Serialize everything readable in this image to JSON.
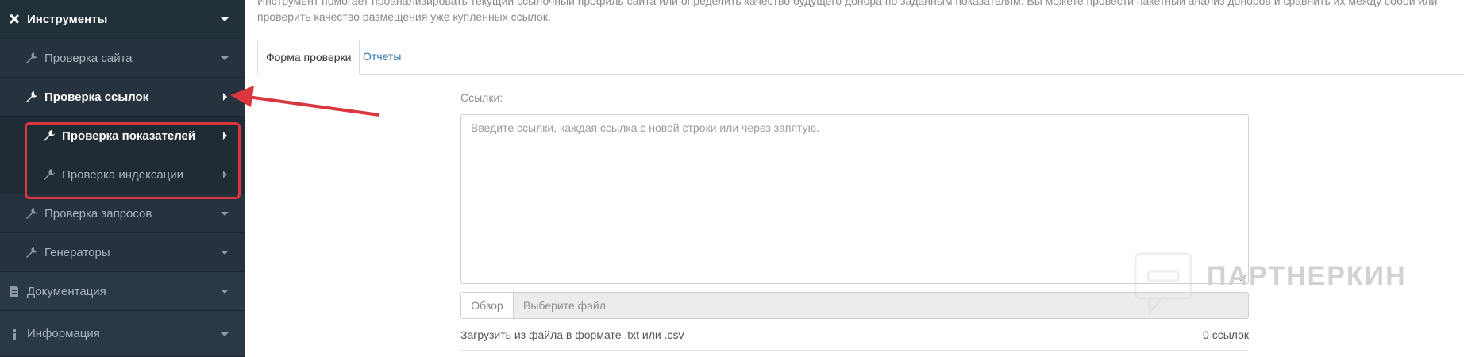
{
  "sidebar": {
    "items": [
      {
        "label": "Инструменты",
        "icon": "tools-icon"
      },
      {
        "label": "Проверка сайта",
        "icon": "wrench-icon"
      },
      {
        "label": "Проверка ссылок",
        "icon": "wrench-icon"
      },
      {
        "label": "Проверка показателей",
        "icon": "wrench-icon"
      },
      {
        "label": "Проверка индексации",
        "icon": "wrench-icon"
      },
      {
        "label": "Проверка запросов",
        "icon": "wrench-icon"
      },
      {
        "label": "Генераторы",
        "icon": "wrench-icon"
      },
      {
        "label": "Документация",
        "icon": "document-icon"
      },
      {
        "label": "Информация",
        "icon": "info-icon"
      }
    ]
  },
  "main": {
    "intro": "Инструмент помогает проанализировать текущий ссылочный профиль сайта или определить качество будущего донора по заданным показателям. Вы можете провести пакетный анализ доноров и сравнить их между собой или проверить качество размещения уже купленных ссылок.",
    "tabs": [
      "Форма проверки",
      "Отчеты"
    ],
    "links_label": "Ссылки:",
    "textarea_placeholder": "Введите ссылки, каждая ссылка с новой строки или через запятую.",
    "browse_label": "Обзор",
    "file_placeholder": "Выберите файл",
    "upload_hint": "Загрузить из файла в формате .txt или .csv",
    "links_count": "0 ссылок"
  },
  "watermark": "ПАРТНЕРКИН",
  "colors": {
    "sidebar": "#2b3945",
    "accent": "#3778b4",
    "highlight": "#d9363e"
  }
}
